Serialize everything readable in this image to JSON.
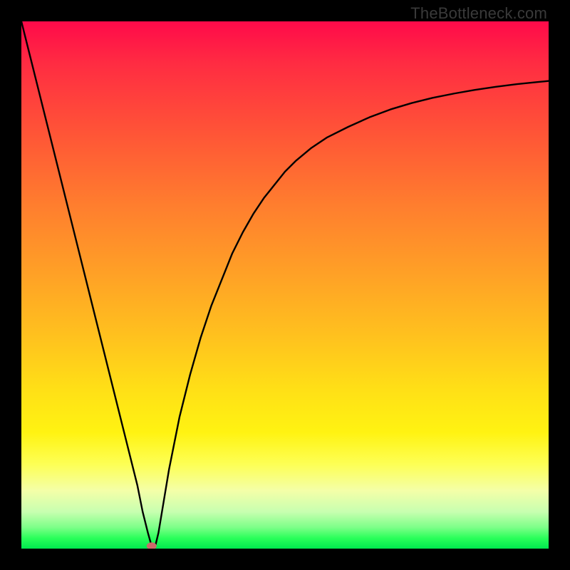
{
  "watermark": {
    "text": "TheBottleneck.com"
  },
  "chart_data": {
    "type": "line",
    "title": "",
    "xlabel": "",
    "ylabel": "",
    "xlim": [
      0,
      100
    ],
    "ylim": [
      0,
      100
    ],
    "grid": false,
    "curve_x_percent": [
      0,
      2,
      4,
      6,
      8,
      10,
      12,
      14,
      16,
      18,
      20,
      22,
      23,
      24,
      24.7,
      25.4,
      26,
      27,
      28,
      30,
      32,
      34,
      36,
      38,
      40,
      42,
      44,
      46,
      48,
      50,
      52,
      55,
      58,
      62,
      66,
      70,
      74,
      78,
      82,
      86,
      90,
      94,
      98,
      100
    ],
    "curve_y_percent": [
      100,
      92,
      84,
      76,
      68,
      60,
      52,
      44,
      36,
      28,
      20,
      12,
      7,
      3,
      0.5,
      0.5,
      3,
      9,
      15,
      25,
      33,
      40,
      46,
      51,
      56,
      60,
      63.5,
      66.5,
      69,
      71.5,
      73.5,
      76,
      78,
      80,
      81.8,
      83.3,
      84.5,
      85.5,
      86.3,
      87,
      87.6,
      88.1,
      88.5,
      88.7
    ],
    "marker": {
      "x_percent": 24.7,
      "y_percent": 0.5,
      "color": "#cc6a6a"
    },
    "gradient_stops": [
      {
        "pct": 0,
        "color": "#ff0a4a"
      },
      {
        "pct": 8,
        "color": "#ff2c42"
      },
      {
        "pct": 22,
        "color": "#ff5736"
      },
      {
        "pct": 35,
        "color": "#ff7e2e"
      },
      {
        "pct": 48,
        "color": "#ffa126"
      },
      {
        "pct": 60,
        "color": "#ffc21e"
      },
      {
        "pct": 70,
        "color": "#ffe016"
      },
      {
        "pct": 78,
        "color": "#fff312"
      },
      {
        "pct": 84,
        "color": "#fdff55"
      },
      {
        "pct": 89,
        "color": "#f4ffa8"
      },
      {
        "pct": 93,
        "color": "#c8ffb0"
      },
      {
        "pct": 96,
        "color": "#7cff88"
      },
      {
        "pct": 98,
        "color": "#2aff5a"
      },
      {
        "pct": 100,
        "color": "#00e84e"
      }
    ]
  }
}
